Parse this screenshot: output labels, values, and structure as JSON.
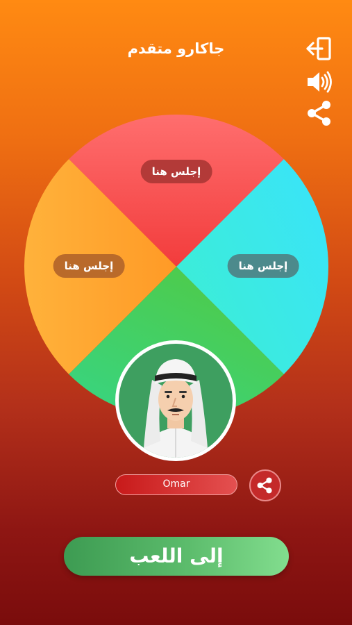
{
  "header": {
    "title": "جاكارو متقدم"
  },
  "controls": {
    "exit_icon": "exit-icon",
    "sound_icon": "speaker-icon",
    "share_icon": "share-icon"
  },
  "board": {
    "seats": [
      {
        "position": "top",
        "label": "إجلس هنا",
        "color": "#ff5a5a"
      },
      {
        "position": "left",
        "label": "إجلس هنا",
        "color": "#ffa733"
      },
      {
        "position": "right",
        "label": "إجلس هنا",
        "color": "#33e4ff"
      },
      {
        "position": "bottom",
        "color": "#3ecd66"
      }
    ]
  },
  "player": {
    "name": "Omar"
  },
  "actions": {
    "play_label": "إلى اللعب"
  }
}
